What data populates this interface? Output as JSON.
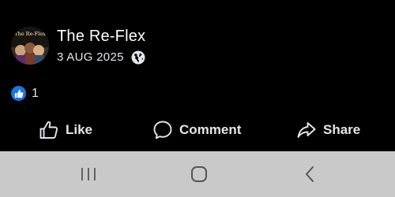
{
  "post": {
    "page_name": "The Re-Flex",
    "date": "3 AUG 2025",
    "audience_icon": "globe-icon",
    "avatar_text": "The Re-Flex"
  },
  "reactions": {
    "icon": "thumbs-up-icon",
    "count": "1",
    "badge_color": "#1b74e4"
  },
  "actions": {
    "like_label": "Like",
    "comment_label": "Comment",
    "share_label": "Share"
  },
  "navbar": {
    "recent_icon": "recent-apps-icon",
    "home_icon": "home-icon",
    "back_icon": "back-icon",
    "background": "#c9c9c9"
  }
}
